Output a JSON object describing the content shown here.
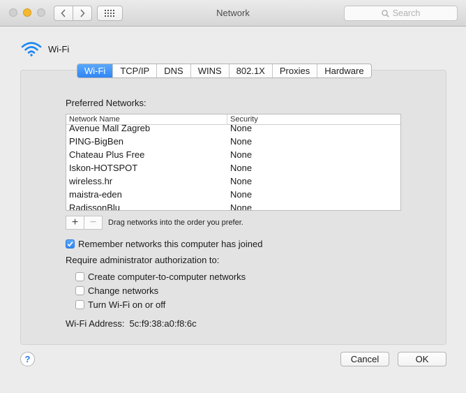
{
  "window": {
    "title": "Network"
  },
  "toolbar": {
    "search_placeholder": "Search"
  },
  "header": {
    "label": "Wi-Fi"
  },
  "tabs": [
    "Wi-Fi",
    "TCP/IP",
    "DNS",
    "WINS",
    "802.1X",
    "Proxies",
    "Hardware"
  ],
  "active_tab": "Wi-Fi",
  "preferred": {
    "label": "Preferred Networks:",
    "columns": [
      "Network Name",
      "Security"
    ],
    "rows": [
      {
        "name": "Avenue Mall Zagreb",
        "security": "None"
      },
      {
        "name": "PING-BigBen",
        "security": "None"
      },
      {
        "name": "Chateau Plus Free",
        "security": "None"
      },
      {
        "name": "Iskon-HOTSPOT",
        "security": "None"
      },
      {
        "name": "wireless.hr",
        "security": "None"
      },
      {
        "name": "maistra-eden",
        "security": "None"
      },
      {
        "name": "RadissonBlu",
        "security": "None"
      }
    ],
    "add_label": "+",
    "remove_label": "−",
    "drag_hint": "Drag networks into the order you prefer."
  },
  "remember": {
    "label": "Remember networks this computer has joined",
    "checked": true
  },
  "require_label": "Require administrator authorization to:",
  "options": [
    {
      "label": "Create computer-to-computer networks",
      "checked": false
    },
    {
      "label": "Change networks",
      "checked": false
    },
    {
      "label": "Turn Wi-Fi on or off",
      "checked": false
    }
  ],
  "address": {
    "label": "Wi-Fi Address:",
    "value": "5c:f9:38:a0:f8:6c"
  },
  "buttons": {
    "help": "?",
    "cancel": "Cancel",
    "ok": "OK"
  },
  "colors": {
    "accent": "#2f86f6",
    "wifi": "#1e88f0",
    "minimize": "#f5b82e"
  }
}
